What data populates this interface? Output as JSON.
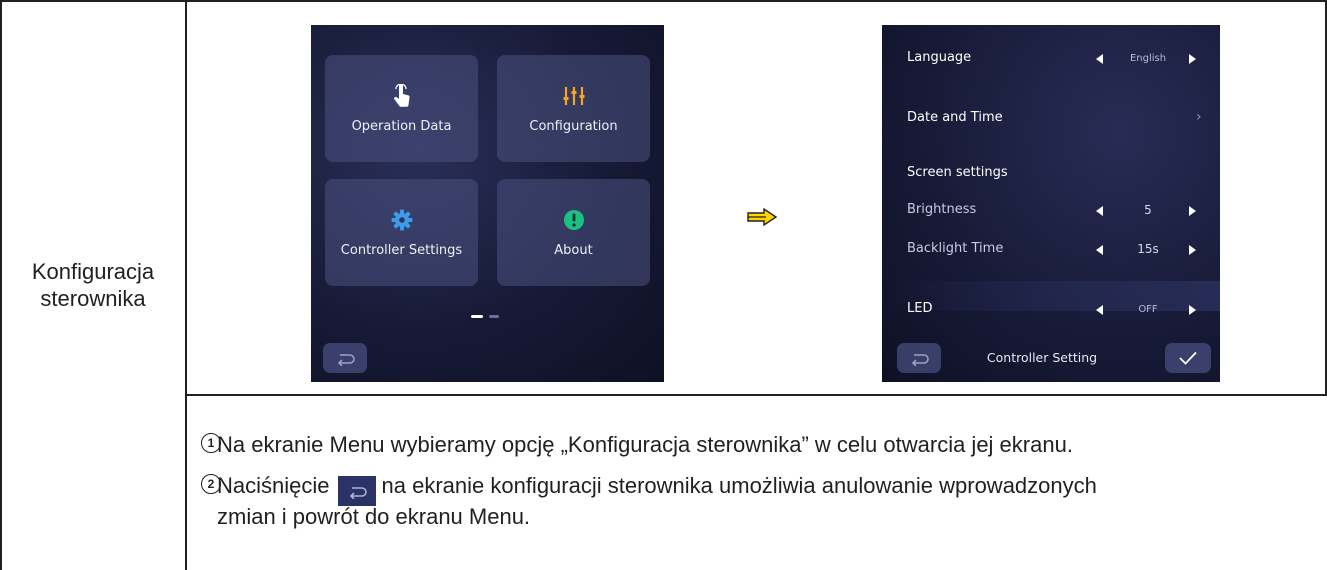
{
  "row_label": {
    "line1": "Konfiguracja",
    "line2": "sterownika"
  },
  "menu_screen": {
    "tiles": [
      {
        "label": "Operation Data",
        "icon": "touch-icon"
      },
      {
        "label": "Configuration",
        "icon": "sliders-icon"
      },
      {
        "label": "Controller Settings",
        "icon": "gear-icon"
      },
      {
        "label": "About",
        "icon": "info-icon"
      }
    ],
    "back_icon": "return-icon"
  },
  "arrow_icon": "arrow-right-icon",
  "settings_screen": {
    "language": {
      "label": "Language",
      "value": "English"
    },
    "date_time": {
      "label": "Date and Time"
    },
    "screen_settings": {
      "label": "Screen settings"
    },
    "brightness": {
      "label": "Brightness",
      "value": "5"
    },
    "backlight": {
      "label": "Backlight Time",
      "value": "15s"
    },
    "led": {
      "label": "LED",
      "value": "OFF"
    },
    "footer_title": "Controller Setting",
    "back_icon": "return-icon",
    "confirm_icon": "checkmark-icon"
  },
  "instructions": {
    "step1_num": "1",
    "step1_text": "Na ekranie Menu wybieramy opcję „Konfiguracja sterownika” w celu otwarcia jej ekranu.",
    "step2_num": "2",
    "step2_before": "Naciśnięcie",
    "step2_after": "na ekranie konfiguracji sterownika umożliwia anulowanie wprowadzonych",
    "step2_line2": "zmian i powrót do ekranu Menu."
  },
  "colors": {
    "accent_orange": "#f5a623",
    "info_green": "#19c37d",
    "gear_blue": "#3d9be9",
    "arrow_yellow": "#ffd400"
  }
}
